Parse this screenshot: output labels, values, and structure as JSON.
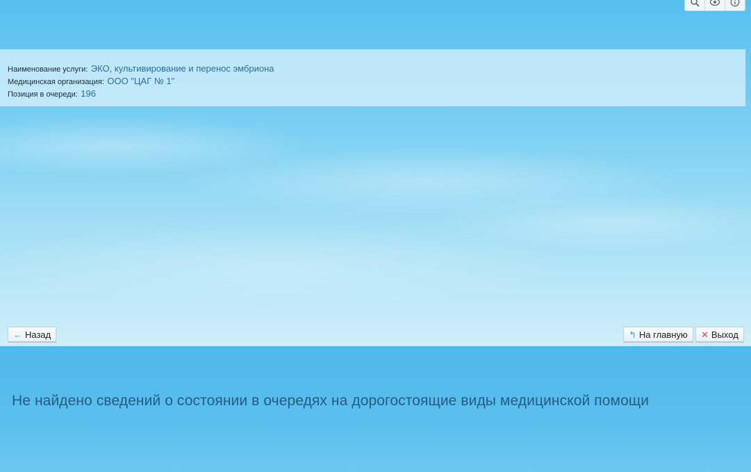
{
  "toolbar": {
    "icons": [
      "zoom-icon",
      "eye-icon",
      "info-icon"
    ]
  },
  "info": {
    "service_label": "Наименование услуги:",
    "service_value": "ЭКО, культивирование и перенос эмбриона",
    "org_label": "Медицинская организация:",
    "org_value": "ООО \"ЦАГ № 1\"",
    "position_label": "Позиция в очереди:",
    "position_value": "196"
  },
  "nav": {
    "back_label": "Назад",
    "home_label": "На главную",
    "exit_label": "Выход"
  },
  "message": "Не найдено сведений о состоянии в очередях на дорогостоящие виды медицинской помощи",
  "colors": {
    "accent_text": "#2a6f99",
    "message_text": "#235d82",
    "exit_icon": "#e0443a",
    "arrow_icon": "#4a9fd2"
  }
}
